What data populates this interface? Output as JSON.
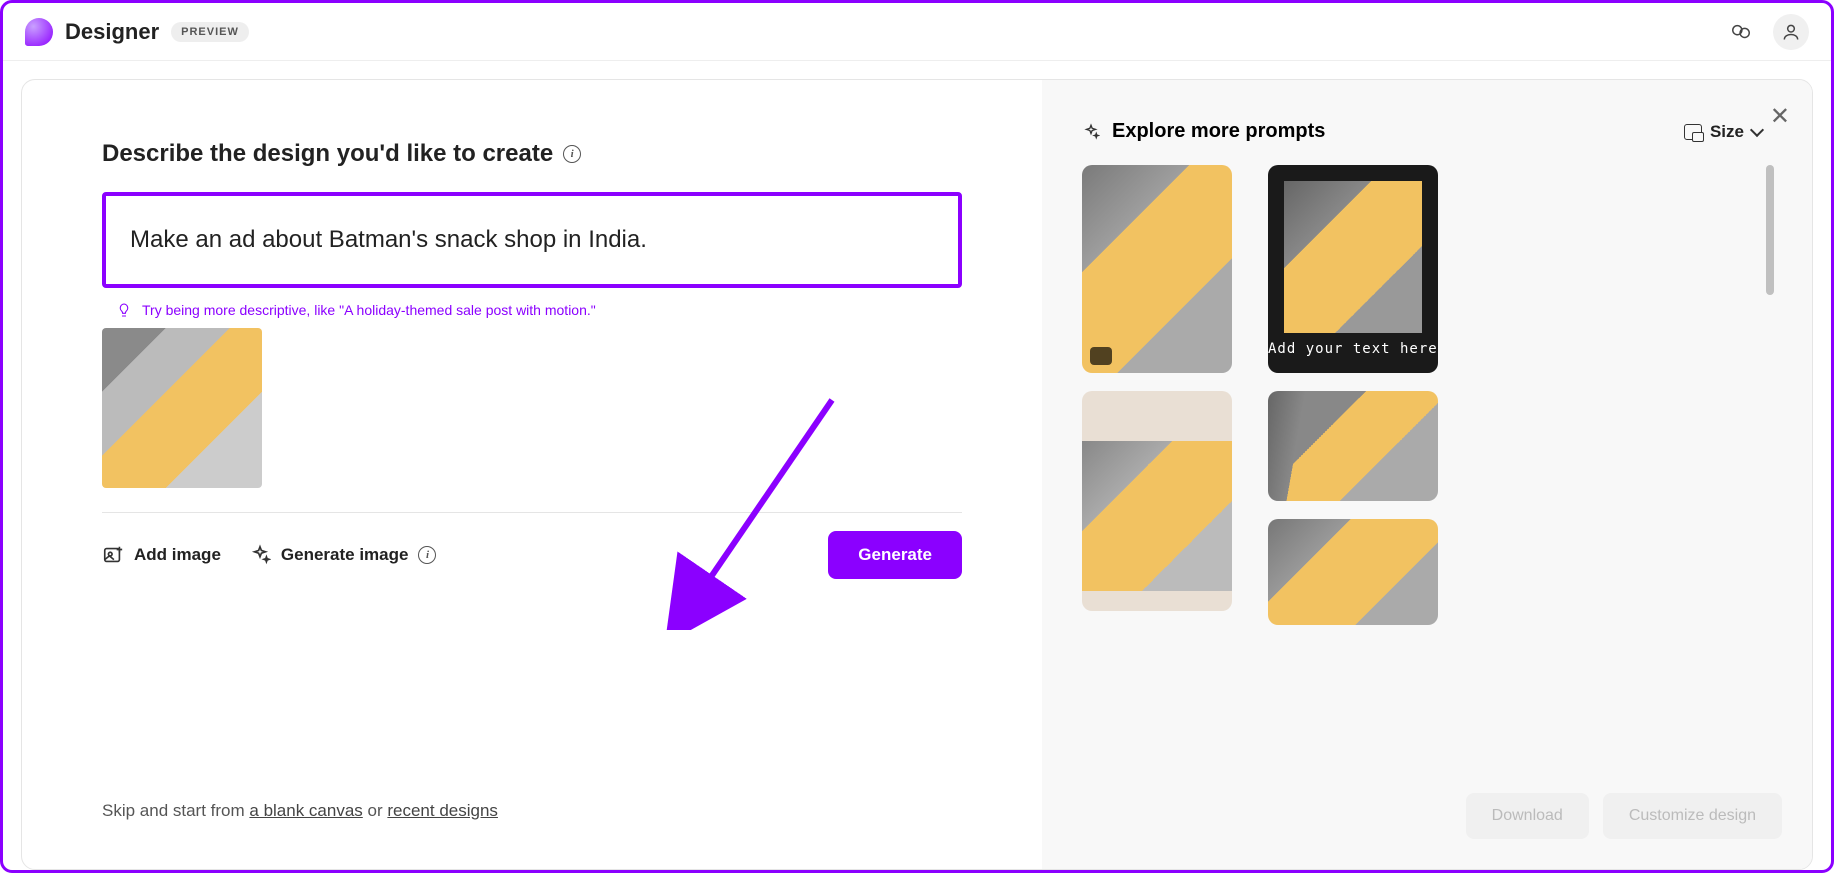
{
  "header": {
    "app_name": "Designer",
    "badge": "PREVIEW"
  },
  "left": {
    "title": "Describe the design you'd like to create",
    "prompt_value": "Make an ad about Batman's snack shop in India.",
    "hint": "Try being more descriptive, like \"A holiday-themed sale post with motion.\"",
    "add_image_label": "Add image",
    "gen_image_label": "Generate image",
    "generate_btn": "Generate",
    "skip_pre": "Skip and start from ",
    "skip_link1": "a blank canvas",
    "skip_mid": " or ",
    "skip_link2": "recent designs"
  },
  "right": {
    "explore_label": "Explore more prompts",
    "size_label": "Size",
    "card3_text": "Add your text here",
    "download_btn": "Download",
    "customize_btn": "Customize design"
  }
}
